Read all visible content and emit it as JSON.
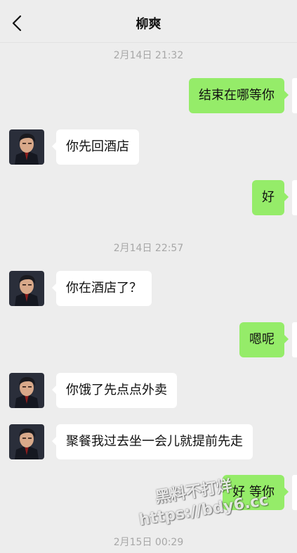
{
  "header": {
    "back_icon": "chevron-left-icon",
    "title": "柳爽"
  },
  "chat": {
    "timestamps": [
      "2月14日 21:32",
      "2月14日 22:57",
      "2月15日 00:29"
    ],
    "messages": [
      {
        "side": "out",
        "text": "结束在哪等你"
      },
      {
        "side": "in",
        "text": "你先回酒店"
      },
      {
        "side": "out",
        "text": "好"
      },
      {
        "side": "in",
        "text": "你在酒店了？"
      },
      {
        "side": "out",
        "text": "嗯呢"
      },
      {
        "side": "in",
        "text": "你饿了先点点外卖"
      },
      {
        "side": "in",
        "text": "聚餐我过去坐一会儿就提前先走"
      },
      {
        "side": "out",
        "text": "好 等你"
      }
    ]
  },
  "watermark": {
    "line1": "黑料不打烊",
    "line2": "https://bdy6.cc"
  },
  "colors": {
    "background": "#ededed",
    "incoming_bubble": "#ffffff",
    "outgoing_bubble": "#95ec69",
    "timestamp": "#a7a7a7"
  }
}
